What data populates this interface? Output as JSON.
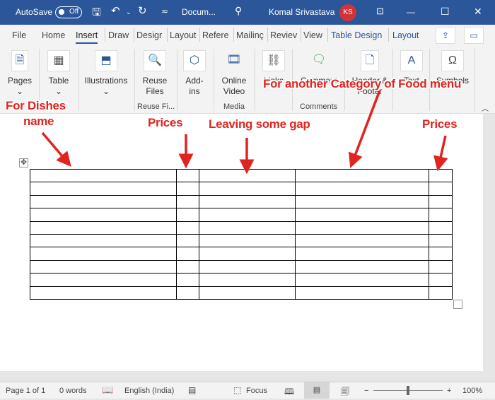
{
  "titlebar": {
    "autosave": "AutoSave",
    "autosave_state": "Off",
    "doc": "Docum...",
    "user": "Komal Srivastava",
    "initials": "KS"
  },
  "tabs": [
    "File",
    "Home",
    "Insert",
    "Draw",
    "Desigr",
    "Layout",
    "Refere",
    "Mailinç",
    "Reviev",
    "View",
    "Table Design",
    "Layout"
  ],
  "ribbon": {
    "buttons": [
      "Pages",
      "Table",
      "Illustrations",
      "Reuse Files",
      "Add-ins",
      "Online Video",
      "Links",
      "Comment",
      "Header & Footer",
      "Text",
      "Symbols"
    ],
    "groups": [
      "Reuse Fi...",
      "Media",
      "Comments"
    ]
  },
  "annotations": {
    "dishes1": "For Dishes",
    "dishes2": "name",
    "prices1": "Prices",
    "gap": "Leaving some gap",
    "another": "For another Category of Food menu",
    "prices2": "Prices"
  },
  "table": {
    "rows": 10,
    "cols": 5
  },
  "status": {
    "page": "Page 1 of 1",
    "words": "0 words",
    "language": "English (India)",
    "focus": "Focus",
    "zoom": "100%",
    "zoom_level": 100
  },
  "colors": {
    "brand": "#2b579a",
    "annotation": "#e0241f"
  }
}
